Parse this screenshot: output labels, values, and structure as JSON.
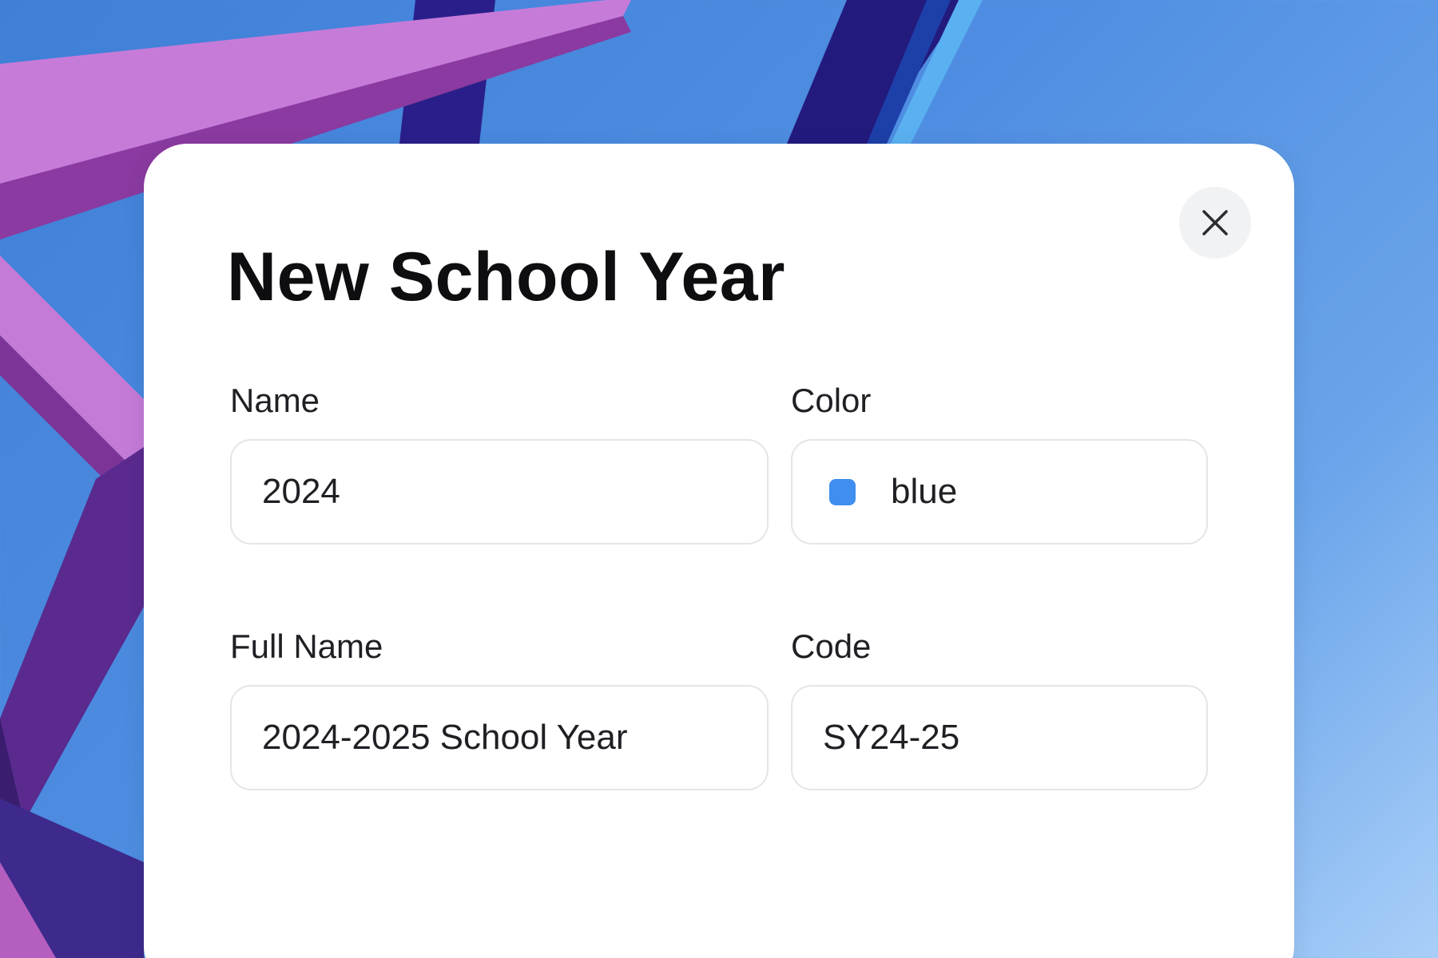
{
  "dialog": {
    "title": "New School Year",
    "close_icon": "close-icon"
  },
  "form": {
    "name": {
      "label": "Name",
      "value": "2024"
    },
    "color": {
      "label": "Color",
      "value": "blue",
      "swatch_color": "#3f8ef0"
    },
    "full_name": {
      "label": "Full Name",
      "value": "2024-2025 School Year"
    },
    "code": {
      "label": "Code",
      "value": "SY24-25"
    }
  }
}
